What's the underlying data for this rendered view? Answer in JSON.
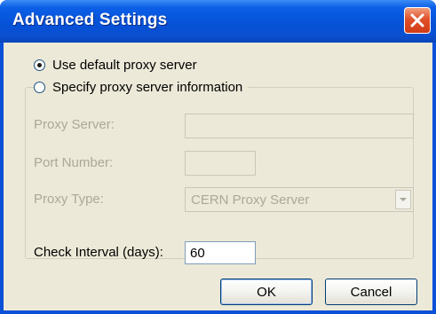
{
  "window": {
    "title": "Advanced Settings"
  },
  "proxy": {
    "option_default": "Use default proxy server",
    "option_specify": "Specify proxy server information",
    "selected": "option_default",
    "server_label": "Proxy Server:",
    "server_value": "",
    "port_label": "Port Number:",
    "port_value": "",
    "type_label": "Proxy Type:",
    "type_value": "CERN Proxy Server"
  },
  "interval": {
    "label": "Check Interval (days):",
    "value": "60"
  },
  "buttons": {
    "ok": "OK",
    "cancel": "Cancel"
  },
  "icons": {
    "close": "close-icon",
    "dropdown": "chevron-down-icon"
  },
  "colors": {
    "titlebar": "#0652d8",
    "close_button": "#e0502a",
    "dialog_background": "#ece9d8",
    "disabled_text": "#aca899"
  }
}
